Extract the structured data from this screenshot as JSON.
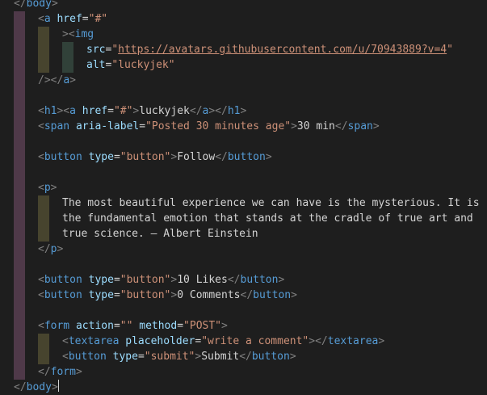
{
  "editor": {
    "lines": [
      {
        "indent": 0,
        "tokens": [
          {
            "t": "</",
            "c": "punc"
          },
          {
            "t": "body",
            "c": "tag"
          },
          {
            "t": ">",
            "c": "punc"
          }
        ]
      },
      {
        "indent": 1,
        "tokens": [
          {
            "t": "<",
            "c": "punc"
          },
          {
            "t": "a",
            "c": "tag"
          },
          {
            "t": " ",
            "c": "plain"
          },
          {
            "t": "href",
            "c": "attr"
          },
          {
            "t": "=",
            "c": "plain"
          },
          {
            "t": "\"#\"",
            "c": "str"
          }
        ]
      },
      {
        "indent": 2,
        "tokens": [
          {
            "t": "><",
            "c": "punc"
          },
          {
            "t": "img",
            "c": "tag"
          }
        ]
      },
      {
        "indent": 3,
        "tokens": [
          {
            "t": "src",
            "c": "attr"
          },
          {
            "t": "=",
            "c": "plain"
          },
          {
            "t": "\"",
            "c": "str"
          },
          {
            "t": "https://avatars.githubusercontent.com/u/70943889?v=4",
            "c": "str url"
          },
          {
            "t": "\"",
            "c": "str"
          }
        ]
      },
      {
        "indent": 3,
        "tokens": [
          {
            "t": "alt",
            "c": "attr"
          },
          {
            "t": "=",
            "c": "plain"
          },
          {
            "t": "\"luckyjek\"",
            "c": "str"
          }
        ]
      },
      {
        "indent": 1,
        "tokens": [
          {
            "t": "/></",
            "c": "punc"
          },
          {
            "t": "a",
            "c": "tag"
          },
          {
            "t": ">",
            "c": "punc"
          }
        ]
      },
      {
        "indent": 1,
        "tokens": []
      },
      {
        "indent": 1,
        "tokens": [
          {
            "t": "<",
            "c": "punc"
          },
          {
            "t": "h1",
            "c": "tag"
          },
          {
            "t": "><",
            "c": "punc"
          },
          {
            "t": "a",
            "c": "tag"
          },
          {
            "t": " ",
            "c": "plain"
          },
          {
            "t": "href",
            "c": "attr"
          },
          {
            "t": "=",
            "c": "plain"
          },
          {
            "t": "\"#\"",
            "c": "str"
          },
          {
            "t": ">",
            "c": "punc"
          },
          {
            "t": "luckyjek",
            "c": "plain"
          },
          {
            "t": "</",
            "c": "punc"
          },
          {
            "t": "a",
            "c": "tag"
          },
          {
            "t": "></",
            "c": "punc"
          },
          {
            "t": "h1",
            "c": "tag"
          },
          {
            "t": ">",
            "c": "punc"
          }
        ]
      },
      {
        "indent": 1,
        "tokens": [
          {
            "t": "<",
            "c": "punc"
          },
          {
            "t": "span",
            "c": "tag"
          },
          {
            "t": " ",
            "c": "plain"
          },
          {
            "t": "aria-label",
            "c": "attr"
          },
          {
            "t": "=",
            "c": "plain"
          },
          {
            "t": "\"Posted 30 minutes age\"",
            "c": "str"
          },
          {
            "t": ">",
            "c": "punc"
          },
          {
            "t": "30 min",
            "c": "plain"
          },
          {
            "t": "</",
            "c": "punc"
          },
          {
            "t": "span",
            "c": "tag"
          },
          {
            "t": ">",
            "c": "punc"
          }
        ]
      },
      {
        "indent": 1,
        "tokens": []
      },
      {
        "indent": 1,
        "tokens": [
          {
            "t": "<",
            "c": "punc"
          },
          {
            "t": "button",
            "c": "tag"
          },
          {
            "t": " ",
            "c": "plain"
          },
          {
            "t": "type",
            "c": "attr"
          },
          {
            "t": "=",
            "c": "plain"
          },
          {
            "t": "\"button\"",
            "c": "str"
          },
          {
            "t": ">",
            "c": "punc"
          },
          {
            "t": "Follow",
            "c": "plain"
          },
          {
            "t": "</",
            "c": "punc"
          },
          {
            "t": "button",
            "c": "tag"
          },
          {
            "t": ">",
            "c": "punc"
          }
        ]
      },
      {
        "indent": 1,
        "tokens": []
      },
      {
        "indent": 1,
        "tokens": [
          {
            "t": "<",
            "c": "punc"
          },
          {
            "t": "p",
            "c": "tag"
          },
          {
            "t": ">",
            "c": "punc"
          }
        ]
      },
      {
        "indent": 2,
        "tokens": [
          {
            "t": "The most beautiful experience we can have is the mysterious. It is",
            "c": "plain"
          }
        ]
      },
      {
        "indent": 2,
        "tokens": [
          {
            "t": "the fundamental emotion that stands at the cradle of true art and",
            "c": "plain"
          }
        ]
      },
      {
        "indent": 2,
        "tokens": [
          {
            "t": "true science. — Albert Einstein",
            "c": "plain"
          }
        ]
      },
      {
        "indent": 1,
        "tokens": [
          {
            "t": "</",
            "c": "punc"
          },
          {
            "t": "p",
            "c": "tag"
          },
          {
            "t": ">",
            "c": "punc"
          }
        ]
      },
      {
        "indent": 1,
        "tokens": []
      },
      {
        "indent": 1,
        "tokens": [
          {
            "t": "<",
            "c": "punc"
          },
          {
            "t": "button",
            "c": "tag"
          },
          {
            "t": " ",
            "c": "plain"
          },
          {
            "t": "type",
            "c": "attr"
          },
          {
            "t": "=",
            "c": "plain"
          },
          {
            "t": "\"button\"",
            "c": "str"
          },
          {
            "t": ">",
            "c": "punc"
          },
          {
            "t": "10 Likes",
            "c": "plain"
          },
          {
            "t": "</",
            "c": "punc"
          },
          {
            "t": "button",
            "c": "tag"
          },
          {
            "t": ">",
            "c": "punc"
          }
        ]
      },
      {
        "indent": 1,
        "tokens": [
          {
            "t": "<",
            "c": "punc"
          },
          {
            "t": "button",
            "c": "tag"
          },
          {
            "t": " ",
            "c": "plain"
          },
          {
            "t": "type",
            "c": "attr"
          },
          {
            "t": "=",
            "c": "plain"
          },
          {
            "t": "\"button\"",
            "c": "str"
          },
          {
            "t": ">",
            "c": "punc"
          },
          {
            "t": "0 Comments",
            "c": "plain"
          },
          {
            "t": "</",
            "c": "punc"
          },
          {
            "t": "button",
            "c": "tag"
          },
          {
            "t": ">",
            "c": "punc"
          }
        ]
      },
      {
        "indent": 1,
        "tokens": []
      },
      {
        "indent": 1,
        "tokens": [
          {
            "t": "<",
            "c": "punc"
          },
          {
            "t": "form",
            "c": "tag"
          },
          {
            "t": " ",
            "c": "plain"
          },
          {
            "t": "action",
            "c": "attr"
          },
          {
            "t": "=",
            "c": "plain"
          },
          {
            "t": "\"\"",
            "c": "str"
          },
          {
            "t": " ",
            "c": "plain"
          },
          {
            "t": "method",
            "c": "attr"
          },
          {
            "t": "=",
            "c": "plain"
          },
          {
            "t": "\"POST\"",
            "c": "str"
          },
          {
            "t": ">",
            "c": "punc"
          }
        ]
      },
      {
        "indent": 2,
        "tokens": [
          {
            "t": "<",
            "c": "punc"
          },
          {
            "t": "textarea",
            "c": "tag"
          },
          {
            "t": " ",
            "c": "plain"
          },
          {
            "t": "placeholder",
            "c": "attr"
          },
          {
            "t": "=",
            "c": "plain"
          },
          {
            "t": "\"write a comment\"",
            "c": "str"
          },
          {
            "t": "></",
            "c": "punc"
          },
          {
            "t": "textarea",
            "c": "tag"
          },
          {
            "t": ">",
            "c": "punc"
          }
        ]
      },
      {
        "indent": 2,
        "tokens": [
          {
            "t": "<",
            "c": "punc"
          },
          {
            "t": "button",
            "c": "tag"
          },
          {
            "t": " ",
            "c": "plain"
          },
          {
            "t": "type",
            "c": "attr"
          },
          {
            "t": "=",
            "c": "plain"
          },
          {
            "t": "\"submit\"",
            "c": "str"
          },
          {
            "t": ">",
            "c": "punc"
          },
          {
            "t": "Submit",
            "c": "plain"
          },
          {
            "t": "</",
            "c": "punc"
          },
          {
            "t": "button",
            "c": "tag"
          },
          {
            "t": ">",
            "c": "punc"
          }
        ]
      },
      {
        "indent": 1,
        "tokens": [
          {
            "t": "</",
            "c": "punc"
          },
          {
            "t": "form",
            "c": "tag"
          },
          {
            "t": ">",
            "c": "punc"
          }
        ]
      },
      {
        "indent": 0,
        "tokens": [
          {
            "t": "</",
            "c": "punc"
          },
          {
            "t": "body",
            "c": "tag"
          },
          {
            "t": ">",
            "c": "punc"
          }
        ],
        "cursor": true
      }
    ]
  },
  "colors": {
    "background": "#1e1e1e",
    "tag": "#569cd6",
    "punctuation": "#808080",
    "attribute": "#9cdcfe",
    "string": "#ce9178",
    "text": "#d4d4d4"
  }
}
